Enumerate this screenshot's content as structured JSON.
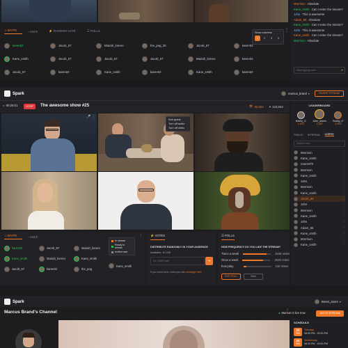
{
  "colors": {
    "accent": "#f07a2a",
    "live": "#e33b3b",
    "online": "#27c24c",
    "bg": "#1b1b1e",
    "panel": "#26262a"
  },
  "top": {
    "tabs": [
      "WHITE",
      "ASKS",
      "RANDOM VOTE",
      "POLLS"
    ],
    "show_columns_label": "Show columns",
    "column_options": [
      "1",
      "2",
      "3",
      "4"
    ],
    "users": [
      [
        "karen02",
        "Jacob_67",
        "Mariah_loreeo",
        "the_pog_25",
        "Jacob_67",
        "karen02"
      ],
      [
        "Kane_smith",
        "Jacob_67",
        "Jacob_67",
        "Jacob_67",
        "Mariah_loreeo",
        "karen02"
      ],
      [
        "Jacob_67",
        "karen02",
        "Kane_smith",
        "karen02",
        "Kane_smith",
        "karen02"
      ]
    ],
    "chat": [
      {
        "user": "Morrison",
        "text": "Absolute"
      },
      {
        "user": "Kane_smith",
        "text": "Can I enter the stream?"
      },
      {
        "user": "John",
        "text": "This is awesome"
      },
      {
        "user": "Adam_55",
        "text": "Absolute"
      },
      {
        "user": "Kane_smith",
        "text": "Can I enter the stream?"
      },
      {
        "user": "John",
        "text": "This is awesome"
      },
      {
        "user": "Kane_smith",
        "text": "Can I enter the stream?"
      },
      {
        "user": "Morrison",
        "text": "Absolute"
      }
    ],
    "chat_placeholder": "Start typing here..."
  },
  "main": {
    "brand": "Spark",
    "user_name": "marcus_brand",
    "share_label": "SHARE STREAM",
    "timer": "00:25:01",
    "stop_label": "STOP",
    "show_title": "The awesome show #25",
    "viewers": "32,024",
    "likes": "123,564",
    "context_menu": [
      "Kick guest",
      "Turn off audio",
      "Turn off video"
    ],
    "tabs": [
      "WHITE",
      "ASKS"
    ],
    "users": [
      [
        "karen02",
        "Jacob_67",
        "Mariah_loreeo"
      ],
      [
        "Kane_smith",
        "Mariah_loreeo",
        "Kane_smith"
      ],
      [
        "Jacob_67",
        "karen02",
        "the_pog"
      ]
    ],
    "filter_menu": [
      "In stream",
      "Ready to stream",
      "Invited user"
    ],
    "extra_user": "Kane_smith",
    "leaderboard": {
      "title": "LEADERBOARD",
      "entries": [
        {
          "name": "Bobby_G",
          "score": "1,203"
        },
        {
          "name": "John_doees",
          "score": "1,542"
        },
        {
          "name": "Bobby_G",
          "score": "1,203"
        }
      ]
    },
    "sidebar_tabs": [
      "PUBLIC",
      "INTERNAL",
      "USERS"
    ],
    "search_placeholder": "Search user",
    "sidebar_users": [
      "Morrison",
      "Kane_smith",
      "rose1979",
      "Morrison",
      "Kane_smith",
      "John",
      "Morrison",
      "Kane_smith",
      "Jacob_69",
      "John",
      "Morrison",
      "Kane_smith",
      "John",
      "Adam_55",
      "Kane_smith",
      "Morrison",
      "Kane_smith"
    ],
    "votes_panel": {
      "tab": "VOTES",
      "title": "DISTRIBUTE RANDOMLY IN YOUR AUDIENCE",
      "available": "Available: 10,235",
      "input_placeholder": "Ex: 2500 vote",
      "footer": "If you need more votes you can",
      "footer_link": "recharge here"
    },
    "polls_panel": {
      "tab": "POLLS",
      "question": "HOW FREQUENCY DO YOU LIKE THE STREAM?",
      "options": [
        {
          "label": "Twice a week",
          "votes": "2545 Votes",
          "fraction": 0.85
        },
        {
          "label": "Once a week",
          "votes": "2535 Votes",
          "fraction": 0.75
        },
        {
          "label": "Everyday",
          "votes": "115 Votes",
          "fraction": 0.12
        }
      ],
      "end_label": "END POLL",
      "new_label": "New"
    }
  },
  "channel": {
    "brand": "Spark",
    "user_name": "Benet_doors",
    "title": "Marcus Brand's Channel",
    "live_text": "Marcus is live now",
    "go_label": "GO TO STREAM",
    "schedule_title": "SCHEDULE",
    "schedule": [
      {
        "day": "22",
        "month": "Feb",
        "weekday": "Tuesday",
        "time": "08:00 PM - 09:00 PM"
      },
      {
        "day": "22",
        "month": "Feb",
        "weekday": "Wednesday",
        "time": "08:00 PM - 09:00 PM"
      }
    ]
  }
}
